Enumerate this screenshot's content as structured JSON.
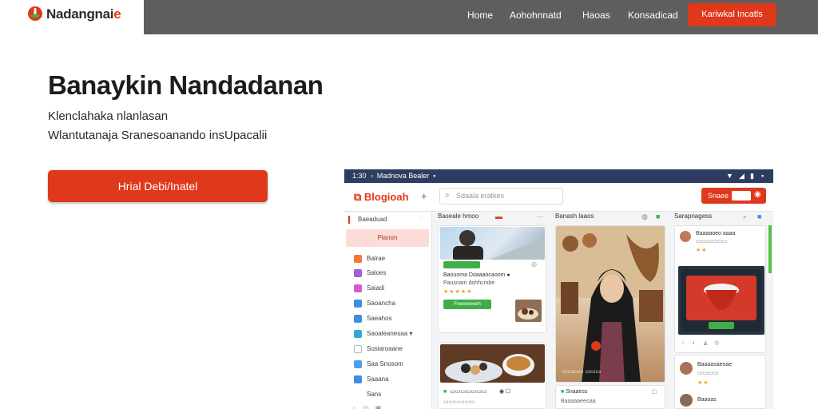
{
  "brand": {
    "name": "Nadangnai",
    "suffix": "e"
  },
  "nav": {
    "links": [
      "Home",
      "Aohohnnatd",
      "Haoas",
      "Konsadicad"
    ],
    "cta": "Kariwkal Incatls"
  },
  "hero": {
    "title": "Banaykin Nandadanan",
    "subtitle_1": "Klenclahaka nlanlasan",
    "subtitle_2": "Wlantutanaja Sranesoanando insUpacalii",
    "cta": "Hrial Debi/Inatel"
  },
  "app": {
    "status_time": "1:30",
    "status_text": "Madnova Bealer",
    "logo": "Blogioah",
    "search_placeholder": "Sdaala eratkes",
    "badge_label": "Snaee",
    "sidebar": {
      "header": "Baeaduad",
      "active": "Planon",
      "items": [
        {
          "label": "Balrae",
          "color": "#f07b31"
        },
        {
          "label": "Saloes",
          "color": "#a25fd9"
        },
        {
          "label": "Saiadi",
          "color": "#d35ad0"
        },
        {
          "label": "Saoancha",
          "color": "#3f8ce3"
        },
        {
          "label": "Saeahos",
          "color": "#3f8ce3"
        },
        {
          "label": "Saoaleanesaa",
          "color": "#2fa8d8"
        },
        {
          "label": "Sosiaroaane",
          "color": "#b8b8b8"
        },
        {
          "label": "Saa Snosom",
          "color": "#4aa0ea"
        },
        {
          "label": "Saaana",
          "color": "#3f8ce3"
        },
        {
          "label": "Sans",
          "color": "#ffffff"
        }
      ]
    },
    "columns": [
      {
        "title": "Baseale hmoo"
      },
      {
        "title": "Banash laaos"
      },
      {
        "title": "Sarapnagess"
      }
    ],
    "cards": {
      "c1_title": "Baouoma Doaaaocaoom",
      "c1_sub": "Pausnam dohhcmbe",
      "c1_btn": "Fneeeeeeeh",
      "c3_name": "Baaaaoeo aaaa",
      "c3_line": "Sanaoaaaeeaee",
      "c3_btn": "Bonso",
      "c3_name2": "Baaaasaeoae",
      "c4_title": "Snaaess",
      "c4_sub": "Baaaaaeeoaa",
      "c5_title": "Baaoas"
    },
    "accent": "#e0381a"
  }
}
